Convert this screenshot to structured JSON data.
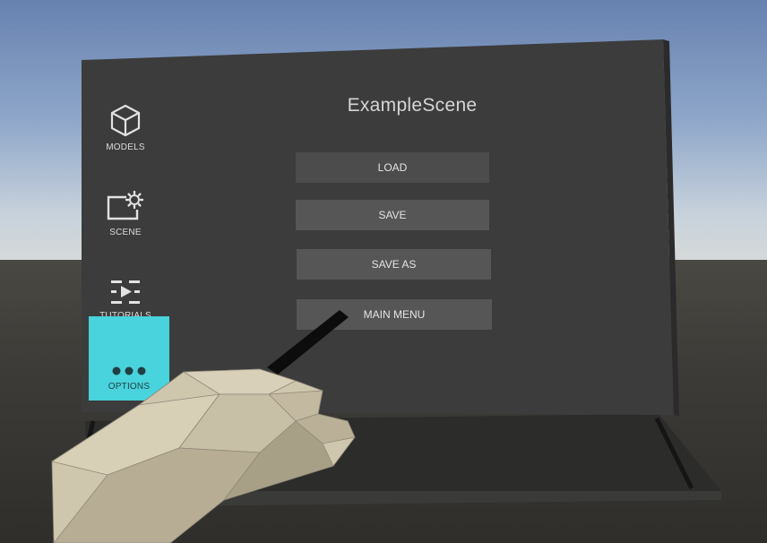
{
  "panel": {
    "title": "ExampleScene"
  },
  "sidebar": {
    "items": [
      {
        "label": "MODELS",
        "icon": "cube-icon"
      },
      {
        "label": "SCENE",
        "icon": "scene-settings-icon"
      },
      {
        "label": "TUTORIALS",
        "icon": "tutorials-play-icon"
      },
      {
        "label": "OPTIONS",
        "icon": "more-dots-icon",
        "active": true
      }
    ]
  },
  "menu": {
    "buttons": [
      {
        "label": "LOAD"
      },
      {
        "label": "SAVE"
      },
      {
        "label": "SAVE AS"
      },
      {
        "label": "MAIN MENU"
      }
    ]
  },
  "colors": {
    "panel": "#3c3c3c",
    "button": "#565656",
    "active_tab": "#49d3dc",
    "hand": "#cfc6ae"
  }
}
